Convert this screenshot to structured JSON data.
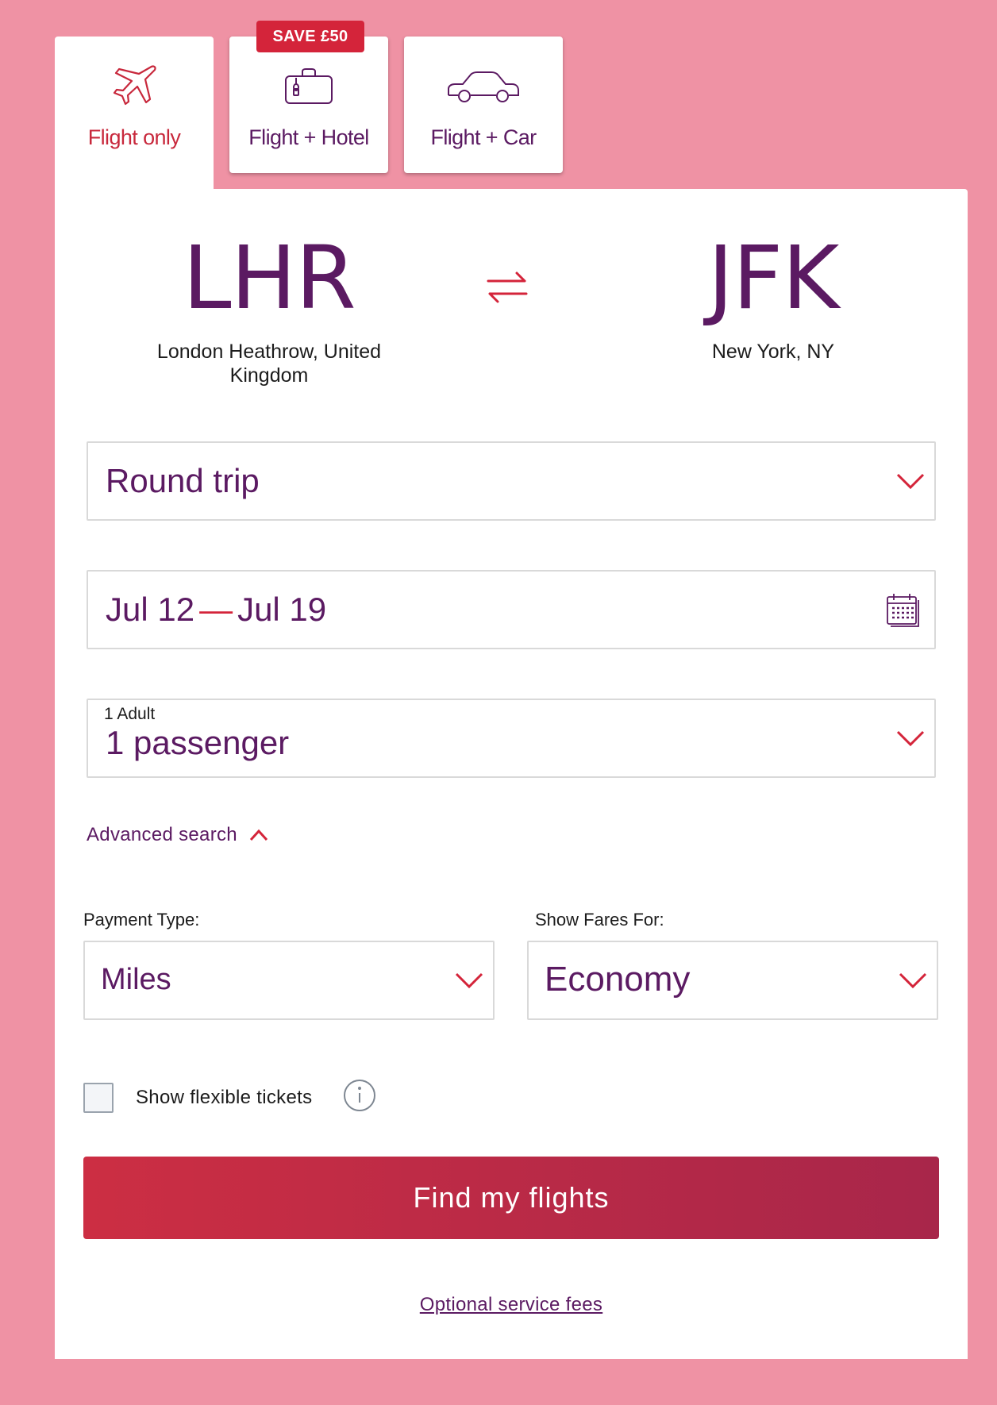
{
  "tabs": {
    "flight_only": {
      "label": "Flight only",
      "icon": "airplane-icon"
    },
    "flight_hotel": {
      "label": "Flight + Hotel",
      "icon": "luggage-icon",
      "badge": "SAVE £50"
    },
    "flight_car": {
      "label": "Flight + Car",
      "icon": "car-icon"
    }
  },
  "route": {
    "origin": {
      "code": "LHR",
      "name": "London Heathrow, United Kingdom"
    },
    "destination": {
      "code": "JFK",
      "name": "New York, NY"
    },
    "swap_icon": "swap-arrows-icon"
  },
  "trip_type": {
    "value": "Round trip"
  },
  "dates": {
    "start": "Jul 12",
    "separator": "—",
    "end": "Jul 19",
    "icon": "calendar-icon"
  },
  "passengers": {
    "sublabel": "1 Adult",
    "value": "1 passenger"
  },
  "advanced_search": {
    "label": "Advanced search",
    "expanded": true
  },
  "payment": {
    "label": "Payment Type:",
    "value": "Miles"
  },
  "fares": {
    "label": "Show Fares For:",
    "value": "Economy"
  },
  "flexible": {
    "label": "Show flexible tickets",
    "checked": false,
    "icon": "info-icon"
  },
  "cta": {
    "label": "Find my flights"
  },
  "fees_link": {
    "label": "Optional service fees"
  },
  "colors": {
    "background": "#ef92a4",
    "brand_purple": "#5b1a62",
    "accent_red": "#d4243a"
  }
}
